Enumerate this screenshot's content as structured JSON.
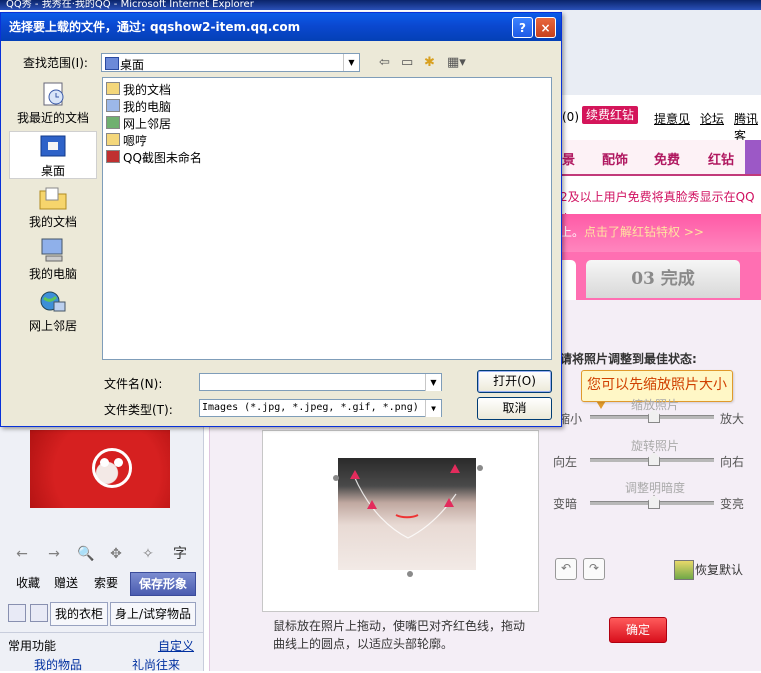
{
  "browser": {
    "title": "QQ秀 - 我秀在·我的QQ - Microsoft Internet Explorer"
  },
  "background_page": {
    "links": {
      "count_suffix": "(0)",
      "vip_button": "续费红钻",
      "feedback": "提意见",
      "forum": "论坛",
      "tencent": "腾讯客"
    },
    "tabs": [
      "景",
      "配饰",
      "免费",
      "红钻"
    ],
    "notice": "2及以上用户免费将真脸秀显示在QQ上",
    "banner_text": "上。",
    "banner_link": "点击了解红钻特权 >>",
    "step3": "03 完成"
  },
  "left_panel": {
    "tools": [
      "←",
      "→",
      "🔍",
      "✥",
      "✧",
      "字"
    ],
    "actions": {
      "collect": "收藏",
      "give": "赠送",
      "request": "索要",
      "save": "保存形象"
    },
    "closet": {
      "my_closet": "我的衣柜",
      "trying": "身上/试穿物品"
    },
    "common": {
      "label": "常用功能",
      "customize": "自定义"
    },
    "bottom_links": {
      "my_items": "我的物品",
      "gifts": "礼尚往来"
    }
  },
  "editor": {
    "title": "请将照片调整到最佳状态:",
    "tooltip": "您可以先缩放照片大小",
    "sliders": [
      {
        "caption": "缩放照片",
        "left": "缩小",
        "right": "放大"
      },
      {
        "caption": "旋转照片",
        "left": "向左",
        "right": "向右"
      },
      {
        "caption": "调整明暗度",
        "left": "变暗",
        "right": "变亮"
      }
    ],
    "undo": "↶",
    "redo": "↷",
    "reset": "恢复默认",
    "confirm": "确定",
    "hint": "鼠标放在照片上拖动，使嘴巴对齐红色线，拖动曲线上的圆点，以适应头部轮廓。"
  },
  "dialog": {
    "title": "选择要上载的文件，通过: qqshow2-item.qq.com",
    "help_btn": "?",
    "close_btn": "×",
    "lookin_label": "查找范围(I):",
    "lookin_value": "桌面",
    "places": [
      {
        "label": "我最近的文档",
        "icon": "recent-documents-icon"
      },
      {
        "label": "桌面",
        "icon": "desktop-icon"
      },
      {
        "label": "我的文档",
        "icon": "my-documents-icon"
      },
      {
        "label": "我的电脑",
        "icon": "my-computer-icon"
      },
      {
        "label": "网上邻居",
        "icon": "network-places-icon"
      }
    ],
    "files": [
      {
        "name": "我的文档",
        "icon": "folder-documents-icon",
        "color": "#f4d77b"
      },
      {
        "name": "我的电脑",
        "icon": "computer-icon",
        "color": "#9cb8e8"
      },
      {
        "name": "网上邻居",
        "icon": "network-icon",
        "color": "#6fb06f"
      },
      {
        "name": "嗯哼",
        "icon": "folder-icon",
        "color": "#f4d77b"
      },
      {
        "name": "QQ截图未命名",
        "icon": "png-file-icon",
        "color": "#c03030"
      }
    ],
    "filename_label": "文件名(N):",
    "filename_value": "",
    "filetype_label": "文件类型(T):",
    "filetype_value": "Images (*.jpg, *.jpeg, *.gif, *.png)",
    "open_button": "打开(O)",
    "cancel_button": "取消"
  },
  "colors": {
    "dialog_title": "#0a5ce8",
    "accent_pink": "#d4155a",
    "confirm": "#d80f1c"
  }
}
